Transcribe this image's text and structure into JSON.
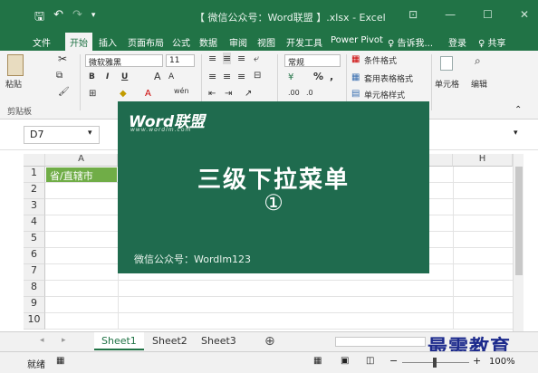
{
  "window": {
    "title": "【 微信公众号：Word联盟 】.xlsx - Excel",
    "qat": {
      "save": "🖫",
      "undo": "↶",
      "redo": "↷",
      "more": "▾"
    },
    "buttons": {
      "options": "⊡",
      "minimize": "—",
      "maximize": "☐",
      "close": "✕"
    }
  },
  "tabs": {
    "file": "文件",
    "home": "开始",
    "insert": "插入",
    "page_layout": "页面布局",
    "formulas": "公式",
    "data": "数据",
    "review": "审阅",
    "view": "视图",
    "developer": "开发工具",
    "powerpivot": "Power Pivot",
    "tell_me": "♀ 告诉我...",
    "login": "登录",
    "share": "♀ 共享"
  },
  "ribbon": {
    "paste": "粘贴",
    "clipboard": "剪贴板",
    "font_name": "微软雅黑",
    "font_size": "11",
    "number_format": "常规",
    "cond_format": "条件格式",
    "table_format": "套用表格格式",
    "cell_style": "单元格样式",
    "cells": "单元格",
    "editing": "编辑",
    "bold": "B",
    "italic": "I",
    "underline": "U",
    "grow": "A",
    "shrink": "A",
    "percent": "%",
    "comma": ","
  },
  "formula_bar": {
    "name_box": "D7",
    "dropdown": "▾"
  },
  "grid": {
    "columns": [
      "A",
      "H"
    ],
    "rows": [
      "1",
      "2",
      "3",
      "4",
      "5",
      "6",
      "7",
      "8",
      "9",
      "10"
    ],
    "a1": "省/直辖市"
  },
  "sheets": {
    "tabs": [
      "Sheet1",
      "Sheet2",
      "Sheet3"
    ],
    "active": "Sheet1",
    "add": "⊕"
  },
  "status": {
    "ready": "就绪",
    "zoom": "100%",
    "minus": "−",
    "plus": "+"
  },
  "overlay": {
    "logo": "Word联盟",
    "logo_sub": "www.wordlm.com",
    "title": "三级下拉菜单",
    "number": "①",
    "footer": "微信公众号：Wordlm123"
  },
  "watermark": "最需教育",
  "colors": {
    "brand": "#217346",
    "overlay": "#1f6b4e",
    "a1_fill": "#70ad47"
  }
}
